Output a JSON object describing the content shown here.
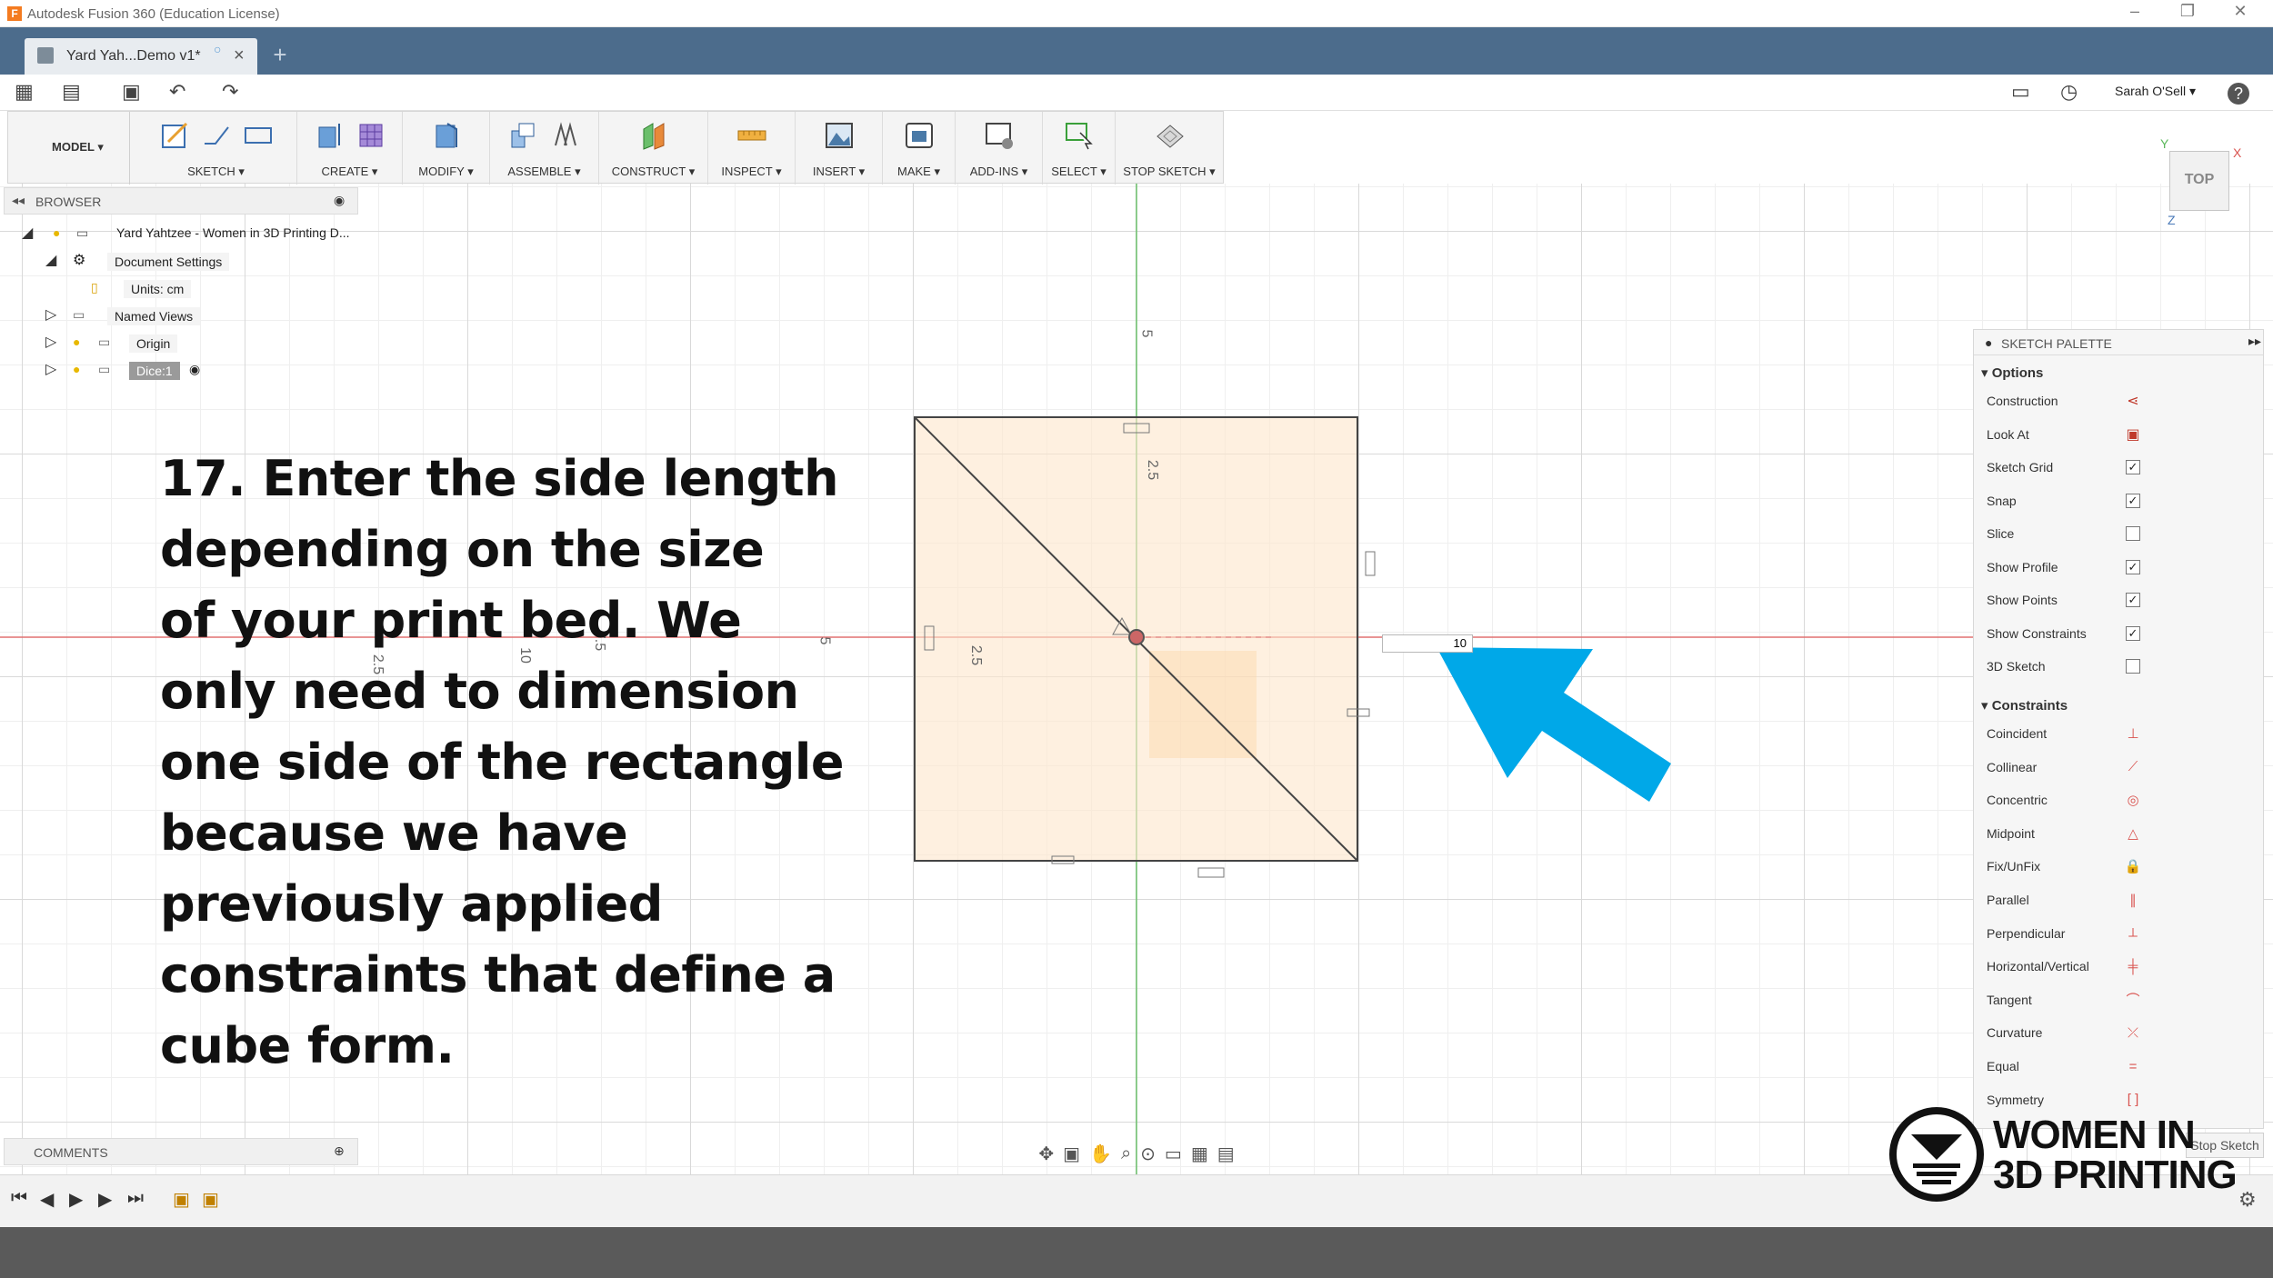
{
  "window": {
    "title": "Autodesk Fusion 360 (Education License)",
    "app_icon": "F"
  },
  "tabs": {
    "document": "Yard Yah...Demo v1*",
    "new_tab": "+"
  },
  "quickbar": {
    "user": "Sarah O'Sell ▾",
    "help": "?"
  },
  "ribbon": {
    "workspace": "MODEL ▾",
    "groups": [
      {
        "label": "SKETCH ▾"
      },
      {
        "label": "CREATE ▾"
      },
      {
        "label": "MODIFY ▾"
      },
      {
        "label": "ASSEMBLE ▾"
      },
      {
        "label": "CONSTRUCT ▾"
      },
      {
        "label": "INSPECT ▾"
      },
      {
        "label": "INSERT ▾"
      },
      {
        "label": "MAKE ▾"
      },
      {
        "label": "ADD-INS ▾"
      },
      {
        "label": "SELECT ▾"
      },
      {
        "label": "STOP SKETCH ▾"
      }
    ]
  },
  "browser": {
    "header": "BROWSER",
    "items": [
      {
        "label": "Yard Yahtzee - Women in 3D Printing D..."
      },
      {
        "label": "Document Settings"
      },
      {
        "label": "Units: cm"
      },
      {
        "label": "Named Views"
      },
      {
        "label": "Origin"
      },
      {
        "label": "Dice:1"
      }
    ]
  },
  "viewport": {
    "axis_labels": [
      "5",
      "2.5",
      "2.5",
      "5",
      "2.5",
      "7.5",
      "10"
    ],
    "dimension_value": "10"
  },
  "viewcube": {
    "face": "TOP",
    "axis_x": "X",
    "axis_y": "Y",
    "axis_z": "Z"
  },
  "palette": {
    "header": "SKETCH PALETTE",
    "options_title": "Options",
    "options": [
      {
        "label": "Construction",
        "type": "icon",
        "icon": "construction-icon"
      },
      {
        "label": "Look At",
        "type": "icon",
        "icon": "look-at-icon"
      },
      {
        "label": "Sketch Grid",
        "type": "checkbox",
        "checked": true
      },
      {
        "label": "Snap",
        "type": "checkbox",
        "checked": true
      },
      {
        "label": "Slice",
        "type": "checkbox",
        "checked": false
      },
      {
        "label": "Show Profile",
        "type": "checkbox",
        "checked": true
      },
      {
        "label": "Show Points",
        "type": "checkbox",
        "checked": true
      },
      {
        "label": "Show Constraints",
        "type": "checkbox",
        "checked": true
      },
      {
        "label": "3D Sketch",
        "type": "checkbox",
        "checked": false
      }
    ],
    "constraints_title": "Constraints",
    "constraints": [
      {
        "label": "Coincident",
        "icon": "coincident-icon"
      },
      {
        "label": "Collinear",
        "icon": "collinear-icon"
      },
      {
        "label": "Concentric",
        "icon": "concentric-icon"
      },
      {
        "label": "Midpoint",
        "icon": "midpoint-icon"
      },
      {
        "label": "Fix/UnFix",
        "icon": "fix-icon"
      },
      {
        "label": "Parallel",
        "icon": "parallel-icon"
      },
      {
        "label": "Perpendicular",
        "icon": "perpendicular-icon"
      },
      {
        "label": "Horizontal/Vertical",
        "icon": "horizontal-vertical-icon"
      },
      {
        "label": "Tangent",
        "icon": "tangent-icon"
      },
      {
        "label": "Curvature",
        "icon": "curvature-icon"
      },
      {
        "label": "Equal",
        "icon": "equal-icon"
      },
      {
        "label": "Symmetry",
        "icon": "symmetry-icon"
      }
    ],
    "stop_button": "Stop Sketch"
  },
  "comments": {
    "header": "COMMENTS"
  },
  "instruction": {
    "lines": [
      "17. Enter the side length",
      "depending on the size",
      "of your print bed. We",
      "only need to dimension",
      "one side of the rectangle",
      "because we have",
      "previously applied",
      "constraints that define a",
      "cube form."
    ]
  },
  "logo": {
    "line1": "WOMEN IN",
    "line2": "3D PRINTING"
  },
  "colors": {
    "accent_arrow": "#00a8e8",
    "tabbar": "#4c6c8c",
    "profile_fill": "#fdebd6",
    "axis_red": "#e05050",
    "axis_green": "#5cb85c"
  }
}
